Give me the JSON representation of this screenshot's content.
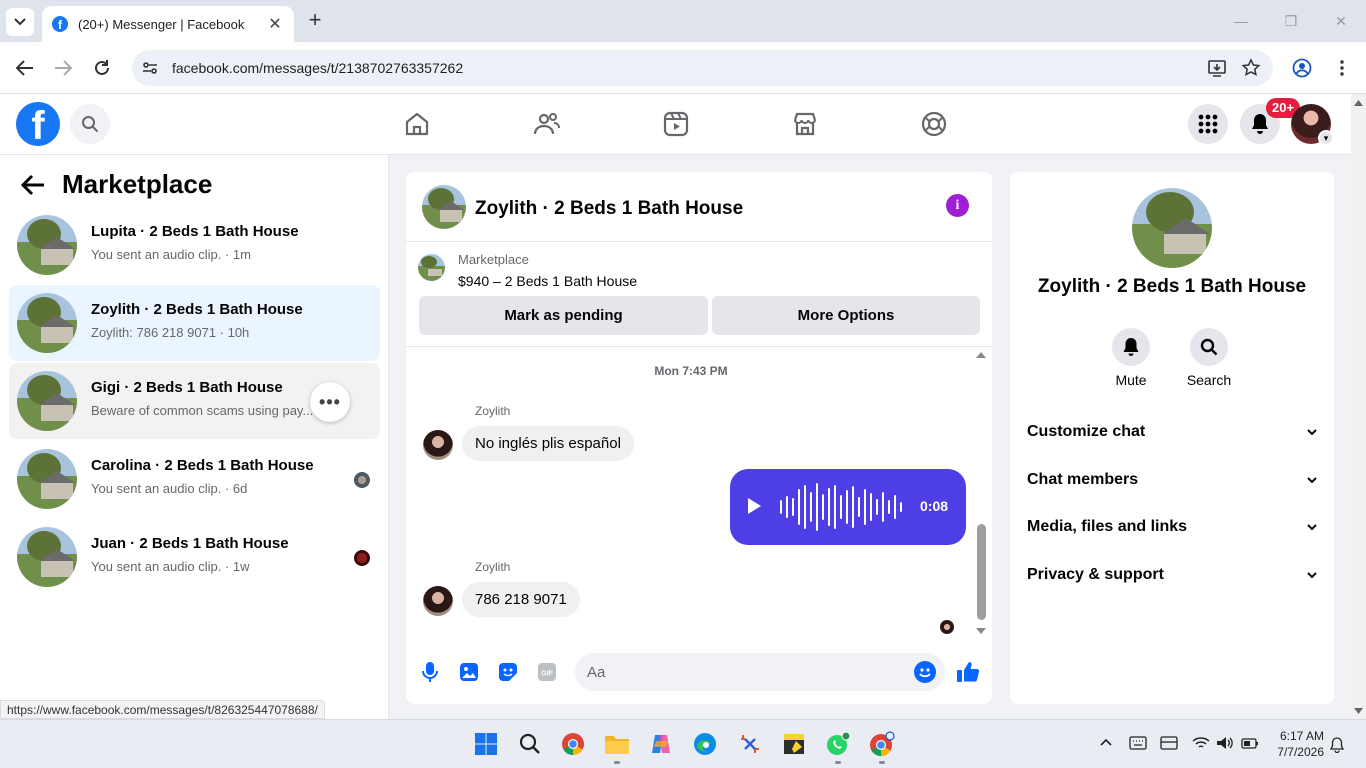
{
  "browser": {
    "tab_title": "(20+) Messenger | Facebook",
    "url": "facebook.com/messages/t/2138702763357262",
    "status_url": "https://www.facebook.com/messages/t/826325447078688/"
  },
  "header": {
    "notification_badge": "20+"
  },
  "sidebar": {
    "title": "Marketplace",
    "conversations": [
      {
        "name": "Lupita · 2 Beds 1 Bath House",
        "preview": "You sent an audio clip. · 1m"
      },
      {
        "name": "Zoylith · 2 Beds 1 Bath House",
        "preview": "Zoylith: 786 218 9071 · 10h"
      },
      {
        "name": "Gigi · 2 Beds 1 Bath House",
        "preview": "Beware of common scams using pay... · 4d"
      },
      {
        "name": "Carolina · 2 Beds 1 Bath House",
        "preview": "You sent an audio clip. · 6d"
      },
      {
        "name": "Juan · 2 Beds 1 Bath House",
        "preview": "You sent an audio clip. · 1w"
      }
    ]
  },
  "chat": {
    "title": "Zoylith · 2 Beds 1 Bath House",
    "listing_label": "Marketplace",
    "listing_price": "$940 – 2 Beds 1 Bath House",
    "mark_pending": "Mark as pending",
    "more_options": "More Options",
    "timestamp": "Mon 7:43 PM",
    "messages": [
      {
        "sender": "Zoylith",
        "text": "No inglés plis español"
      },
      {
        "sender": "Zoylith",
        "text": "786 218 9071"
      }
    ],
    "audio_duration": "0:08",
    "composer_placeholder": "Aa"
  },
  "details": {
    "title": "Zoylith · 2 Beds 1 Bath House",
    "mute": "Mute",
    "search": "Search",
    "sections": [
      "Customize chat",
      "Chat members",
      "Media, files and links",
      "Privacy & support"
    ]
  },
  "taskbar": {
    "time": "6:17 AM",
    "date": "7/7/2026"
  },
  "colors": {
    "facebook_blue": "#1877f2",
    "messenger_accent": "#4e3ee6",
    "info_purple": "#9d1ed5",
    "active_conversation_bg": "#ebf5ff"
  }
}
